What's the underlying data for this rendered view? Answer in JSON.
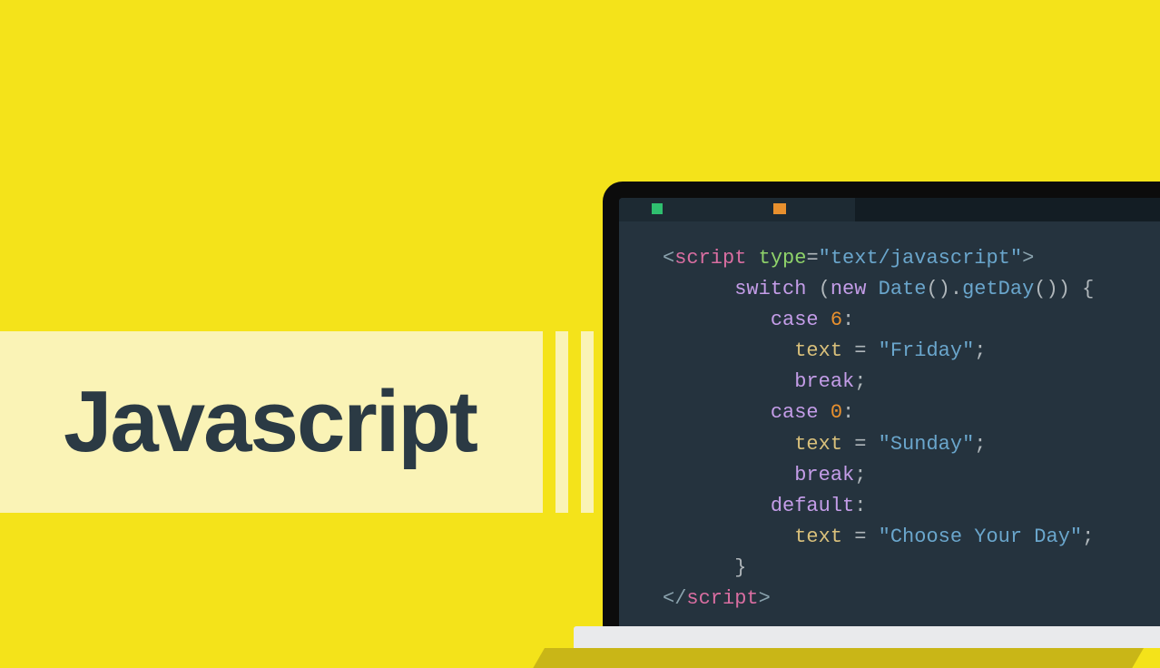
{
  "title": "Javascript",
  "code": {
    "line1": {
      "open": "<",
      "tag": "script",
      "attr": " type",
      "eq": "=",
      "q1": "\"",
      "val": "text/javascript",
      "q2": "\"",
      "close": ">"
    },
    "line2": {
      "kw": "switch",
      "paren1": " (",
      "new": "new",
      "sp": " ",
      "cls": "Date",
      "call1": "().",
      "fn": "getDay",
      "call2": "()) {",
      "brace": ""
    },
    "line3": {
      "kw": "case",
      "sp": " ",
      "num": "6",
      "colon": ":"
    },
    "line4": {
      "var": "text",
      "sp": " ",
      "op": "=",
      "sp2": " ",
      "q1": "\"",
      "str": "Friday",
      "q2": "\"",
      "semi": ";"
    },
    "line5": {
      "kw": "break",
      "semi": ";"
    },
    "line6": {
      "kw": "case",
      "sp": " ",
      "num": "0",
      "colon": ":"
    },
    "line7": {
      "var": "text",
      "sp": " ",
      "op": "=",
      "sp2": " ",
      "q1": "\"",
      "str": "Sunday",
      "q2": "\"",
      "semi": ";"
    },
    "line8": {
      "kw": "break",
      "semi": ";"
    },
    "line9": {
      "kw": "default",
      "colon": ":"
    },
    "line10": {
      "var": "text",
      "sp": " ",
      "op": "=",
      "sp2": " ",
      "q1": "\"",
      "str": "Choose Your Day",
      "q2": "\"",
      "semi": ";"
    },
    "line11": {
      "brace": "}"
    },
    "line12": {
      "open": "</",
      "tag": "script",
      "close": ">"
    }
  }
}
